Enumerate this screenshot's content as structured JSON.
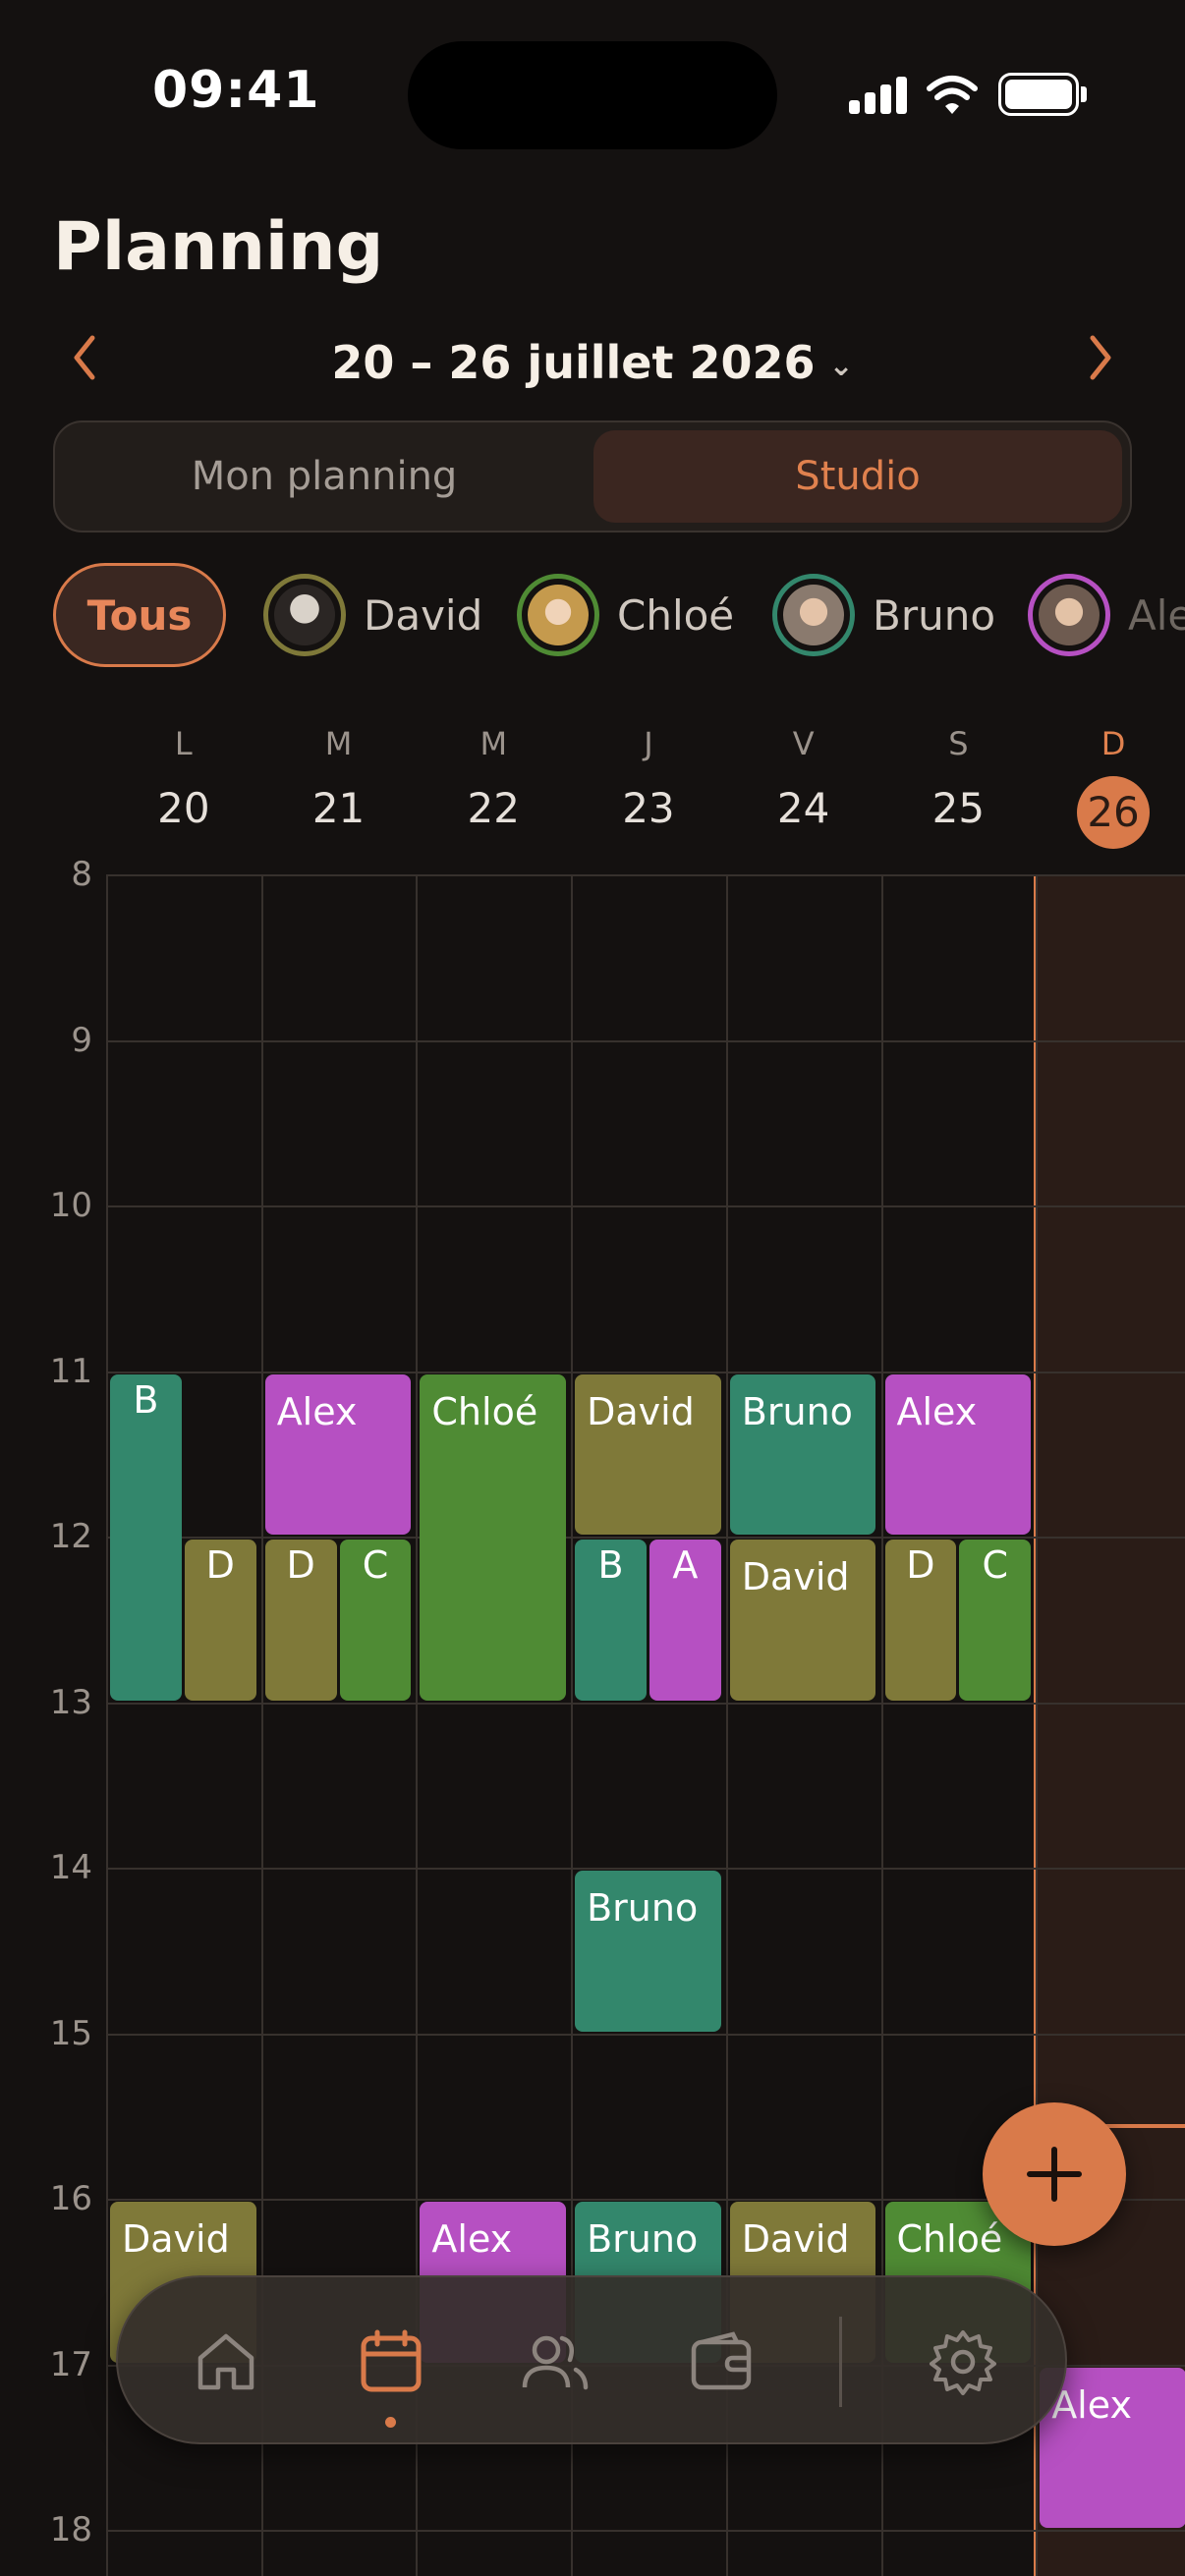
{
  "status_bar": {
    "time": "09:41"
  },
  "header": {
    "title": "Planning",
    "week_range": "20 – 26 juillet 2026"
  },
  "view_toggle": {
    "options": [
      "Mon planning",
      "Studio"
    ],
    "selected": "Studio"
  },
  "filters": {
    "all_label": "Tous",
    "people": [
      {
        "name": "David",
        "color": "#7f7939"
      },
      {
        "name": "Chloé",
        "color": "#4f8b34"
      },
      {
        "name": "Bruno",
        "color": "#33876c"
      },
      {
        "name": "Alex",
        "color": "#b650c2"
      }
    ]
  },
  "days": [
    {
      "letter": "L",
      "date": "20"
    },
    {
      "letter": "M",
      "date": "21"
    },
    {
      "letter": "M",
      "date": "22"
    },
    {
      "letter": "J",
      "date": "23"
    },
    {
      "letter": "V",
      "date": "24"
    },
    {
      "letter": "S",
      "date": "25"
    },
    {
      "letter": "D",
      "date": "26",
      "today": true
    }
  ],
  "hours": [
    "8",
    "9",
    "10",
    "11",
    "12",
    "13",
    "14",
    "15",
    "16",
    "17",
    "18"
  ],
  "events": [
    {
      "day": 0,
      "start": 12,
      "end": 13,
      "label": "D",
      "person": "David"
    },
    {
      "day": 0,
      "start": 11,
      "end": 13,
      "label": "B",
      "person": "Bruno"
    },
    {
      "day": 1,
      "start": 11,
      "end": 12,
      "label": "Alex",
      "person": "Alex"
    },
    {
      "day": 1,
      "start": 12,
      "end": 13,
      "label": "D",
      "person": "David"
    },
    {
      "day": 1,
      "start": 12,
      "end": 13,
      "label": "C",
      "person": "Chloé"
    },
    {
      "day": 2,
      "start": 11,
      "end": 13,
      "label": "Chloé",
      "person": "Chloé"
    },
    {
      "day": 3,
      "start": 11,
      "end": 12,
      "label": "David",
      "person": "David"
    },
    {
      "day": 3,
      "start": 12,
      "end": 13,
      "label": "B",
      "person": "Bruno"
    },
    {
      "day": 3,
      "start": 12,
      "end": 13,
      "label": "A",
      "person": "Alex"
    },
    {
      "day": 3,
      "start": 14,
      "end": 15,
      "label": "Bruno",
      "person": "Bruno"
    },
    {
      "day": 4,
      "start": 11,
      "end": 12,
      "label": "Bruno",
      "person": "Bruno"
    },
    {
      "day": 4,
      "start": 12,
      "end": 13,
      "label": "David",
      "person": "David"
    },
    {
      "day": 5,
      "start": 11,
      "end": 12,
      "label": "Alex",
      "person": "Alex"
    },
    {
      "day": 5,
      "start": 12,
      "end": 13,
      "label": "D",
      "person": "David"
    },
    {
      "day": 5,
      "start": 12,
      "end": 13,
      "label": "C",
      "person": "Chloé"
    },
    {
      "day": 0,
      "start": 16,
      "end": 17,
      "label": "David",
      "person": "David"
    },
    {
      "day": 2,
      "start": 16,
      "end": 17,
      "label": "Alex",
      "person": "Alex"
    },
    {
      "day": 3,
      "start": 16,
      "end": 17,
      "label": "Bruno",
      "person": "Bruno"
    },
    {
      "day": 4,
      "start": 16,
      "end": 17,
      "label": "David",
      "person": "David"
    },
    {
      "day": 5,
      "start": 16,
      "end": 17,
      "label": "Chloé",
      "person": "Chloé"
    },
    {
      "day": 6,
      "start": 17,
      "end": 18,
      "label": "Alex",
      "person": "Alex"
    }
  ],
  "tab_bar": {
    "tabs": [
      {
        "name": "home-icon"
      },
      {
        "name": "calendar-icon",
        "active": true
      },
      {
        "name": "people-icon"
      },
      {
        "name": "wallet-icon"
      },
      {
        "name": "gear-icon"
      }
    ],
    "accent": "#d97a4a"
  }
}
